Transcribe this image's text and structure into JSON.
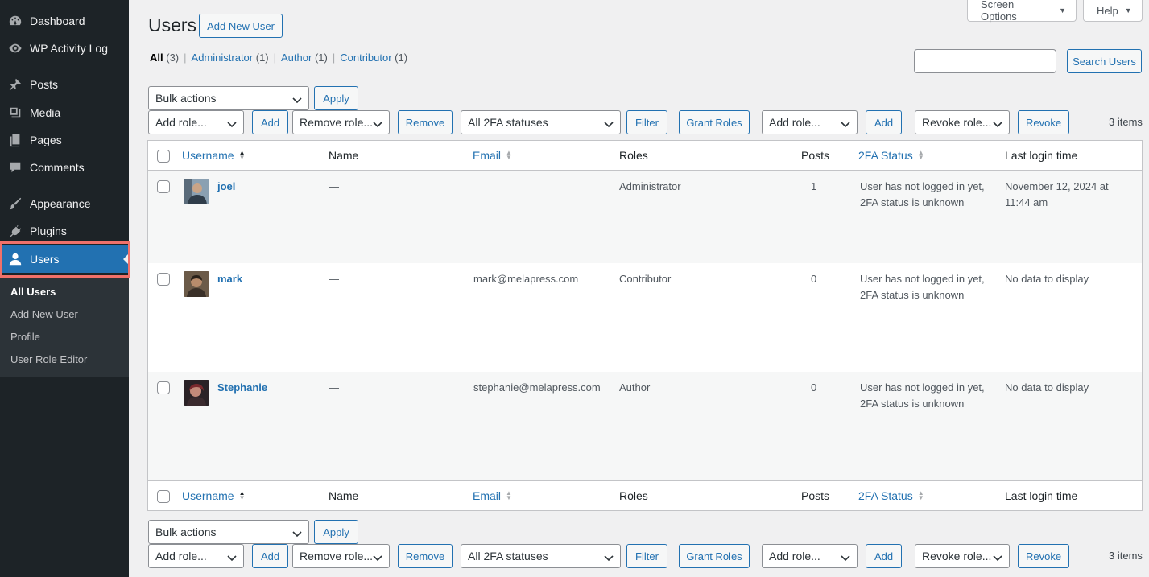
{
  "sidebar": {
    "items": [
      {
        "label": "Dashboard",
        "icon": "dashboard-icon"
      },
      {
        "label": "WP Activity Log",
        "icon": "eye-icon"
      },
      {
        "label": "Posts",
        "icon": "pin-icon"
      },
      {
        "label": "Media",
        "icon": "media-icon"
      },
      {
        "label": "Pages",
        "icon": "pages-icon"
      },
      {
        "label": "Comments",
        "icon": "comment-icon"
      },
      {
        "label": "Appearance",
        "icon": "brush-icon"
      },
      {
        "label": "Plugins",
        "icon": "plug-icon"
      },
      {
        "label": "Users",
        "icon": "user-icon",
        "current": true
      }
    ],
    "submenu": [
      "All Users",
      "Add New User",
      "Profile",
      "User Role Editor"
    ]
  },
  "top": {
    "screen_options": "Screen Options",
    "help": "Help"
  },
  "header": {
    "title": "Users",
    "add_new": "Add New User"
  },
  "filters": {
    "all": "All",
    "all_count": "(3)",
    "administrator": "Administrator",
    "administrator_count": "(1)",
    "author": "Author",
    "author_count": "(1)",
    "contributor": "Contributor",
    "contributor_count": "(1)"
  },
  "search": {
    "button": "Search Users",
    "value": ""
  },
  "toolbar": {
    "bulk_actions": "Bulk actions",
    "apply": "Apply",
    "add_role": "Add role...",
    "add": "Add",
    "remove_role": "Remove role...",
    "remove": "Remove",
    "twofa_statuses": "All 2FA statuses",
    "filter": "Filter",
    "grant_roles": "Grant Roles",
    "revoke_role": "Revoke role...",
    "revoke": "Revoke",
    "items_count": "3 items"
  },
  "table": {
    "columns": {
      "username": "Username",
      "name": "Name",
      "email": "Email",
      "roles": "Roles",
      "posts": "Posts",
      "twofa": "2FA Status",
      "last_login": "Last login time"
    },
    "rows": [
      {
        "username": "joel",
        "name": "—",
        "email": "",
        "role": "Administrator",
        "posts": "1",
        "twofa_line1": "User has not logged in yet,",
        "twofa_line2": "2FA status is unknown",
        "last_login_line1": "November 12, 2024 at",
        "last_login_line2": "11:44 am",
        "avatar_color": "#5a6b7a"
      },
      {
        "username": "mark",
        "name": "—",
        "email": "mark@melapress.com",
        "role": "Contributor",
        "posts": "0",
        "twofa_line1": "User has not logged in yet,",
        "twofa_line2": "2FA status is unknown",
        "last_login_line1": "No data to display",
        "last_login_line2": "",
        "avatar_color": "#4a4038"
      },
      {
        "username": "Stephanie",
        "name": "—",
        "email": "stephanie@melapress.com",
        "role": "Author",
        "posts": "0",
        "twofa_line1": "User has not logged in yet,",
        "twofa_line2": "2FA status is unknown",
        "last_login_line1": "No data to display",
        "last_login_line2": "",
        "avatar_color": "#3a2a2e"
      }
    ]
  },
  "colors": {
    "accent": "#2271b1",
    "sidebar_bg": "#1d2327",
    "highlight": "#f0716a"
  }
}
